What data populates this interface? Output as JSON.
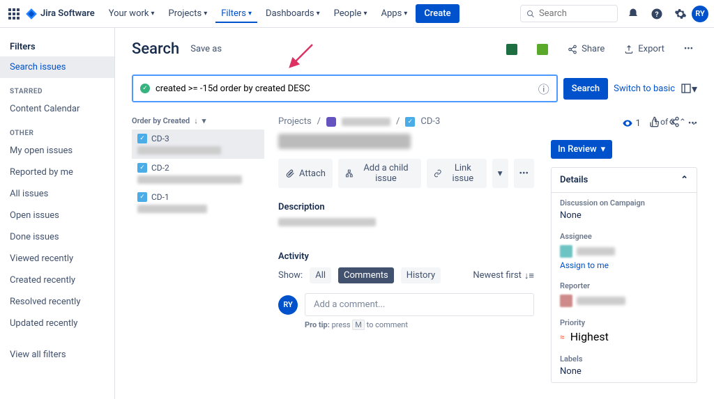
{
  "top": {
    "logo": "Jira Software",
    "nav": [
      "Your work",
      "Projects",
      "Filters",
      "Dashboards",
      "People",
      "Apps"
    ],
    "create": "Create",
    "search_placeholder": "Search",
    "avatar": "RY"
  },
  "sidebar": {
    "title": "Filters",
    "search_issues": "Search issues",
    "starred_heading": "STARRED",
    "starred_items": [
      "Content Calendar"
    ],
    "other_heading": "OTHER",
    "other_items": [
      "My open issues",
      "Reported by me",
      "All issues",
      "Open issues",
      "Done issues",
      "Viewed recently",
      "Created recently",
      "Resolved recently",
      "Updated recently"
    ],
    "view_all": "View all filters"
  },
  "header": {
    "title": "Search",
    "save_as": "Save as",
    "share": "Share",
    "export": "Export"
  },
  "jql": {
    "query": "created >= -15d order by created DESC",
    "search_btn": "Search",
    "switch": "Switch to basic"
  },
  "list": {
    "order_by": "Order by Created",
    "items": [
      {
        "key": "CD-3"
      },
      {
        "key": "CD-2"
      },
      {
        "key": "CD-1"
      }
    ]
  },
  "pagination": "1 of 3",
  "detail": {
    "breadcrumb_projects": "Projects",
    "issue_key": "CD-3",
    "watch_count": "1",
    "attach": "Attach",
    "add_child": "Add a child issue",
    "link_issue": "Link issue",
    "description": "Description",
    "activity": "Activity",
    "show": "Show:",
    "tabs": {
      "all": "All",
      "comments": "Comments",
      "history": "History"
    },
    "newest": "Newest first",
    "avatar": "RY",
    "comment_placeholder": "Add a comment...",
    "protip_pre": "Pro tip:",
    "protip_mid": "press",
    "protip_key": "M",
    "protip_post": "to comment"
  },
  "side": {
    "status": "In Review",
    "details": "Details",
    "discussion_label": "Discussion on Campaign",
    "none": "None",
    "assignee": "Assignee",
    "assign_me": "Assign to me",
    "reporter": "Reporter",
    "priority": "Priority",
    "priority_value": "Highest",
    "labels": "Labels"
  }
}
